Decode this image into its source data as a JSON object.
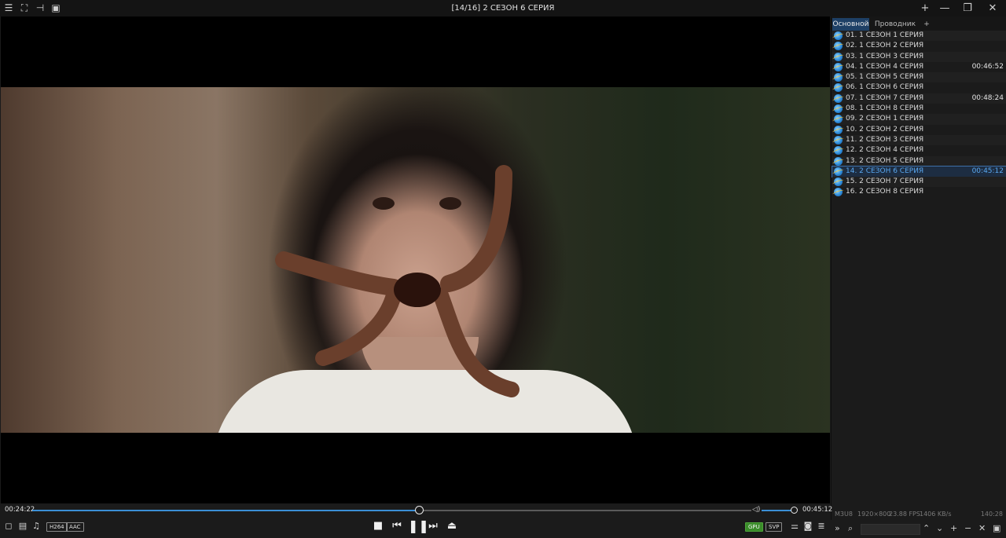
{
  "titlebar": {
    "title": "[14/16]  2 СЕЗОН 6 СЕРИЯ",
    "icons": [
      "menu-icon",
      "fullscreen-icon",
      "pin-icon",
      "mini-player-icon"
    ],
    "window_buttons": [
      "add-icon",
      "minimize-icon",
      "restore-icon",
      "close-icon"
    ]
  },
  "playlist": {
    "tabs": [
      "Основной",
      "Проводник",
      "+"
    ],
    "active_tab": "Основной",
    "items": [
      {
        "name": "01.  1 СЕЗОН 1 СЕРИЯ",
        "duration": ""
      },
      {
        "name": "02.  1 СЕЗОН 2 СЕРИЯ",
        "duration": ""
      },
      {
        "name": "03.  1 СЕЗОН 3 СЕРИЯ",
        "duration": ""
      },
      {
        "name": "04.  1 СЕЗОН 4 СЕРИЯ",
        "duration": "00:46:52"
      },
      {
        "name": "05.  1 СЕЗОН 5 СЕРИЯ",
        "duration": ""
      },
      {
        "name": "06.  1 СЕЗОН 6 СЕРИЯ",
        "duration": ""
      },
      {
        "name": "07.  1 СЕЗОН 7 СЕРИЯ",
        "duration": "00:48:24"
      },
      {
        "name": "08.  1 СЕЗОН 8 СЕРИЯ",
        "duration": ""
      },
      {
        "name": "09.  2 СЕЗОН 1 СЕРИЯ",
        "duration": ""
      },
      {
        "name": "10.  2 СЕЗОН 2 СЕРИЯ",
        "duration": ""
      },
      {
        "name": "11.  2 СЕЗОН 3 СЕРИЯ",
        "duration": ""
      },
      {
        "name": "12.  2 СЕЗОН 4 СЕРИЯ",
        "duration": ""
      },
      {
        "name": "13.  2 СЕЗОН 5 СЕРИЯ",
        "duration": ""
      },
      {
        "name": "14.  2 СЕЗОН 6 СЕРИЯ",
        "duration": "00:45:12",
        "current": true
      },
      {
        "name": "15.  2 СЕЗОН 7 СЕРИЯ",
        "duration": ""
      },
      {
        "name": "16.  2 СЕЗОН 8 СЕРИЯ",
        "duration": ""
      }
    ],
    "status": {
      "format": "M3U8",
      "resolution": "1920×800",
      "fps": "23.88 FPS",
      "bitrate": "1406 KB/s",
      "total_time": "140:28"
    },
    "search_placeholder": ""
  },
  "player": {
    "current_time": "00:24:22",
    "total_time": "00:45:12",
    "progress_fraction": 0.5392,
    "volume_fraction": 1.0,
    "badges": {
      "video_codec": "H264",
      "audio_codec": "AAC",
      "gpu": "GPU",
      "svp": "SVP"
    },
    "accent_color": "#3b8fd6",
    "badge_on_color": "#3a8c2a"
  }
}
